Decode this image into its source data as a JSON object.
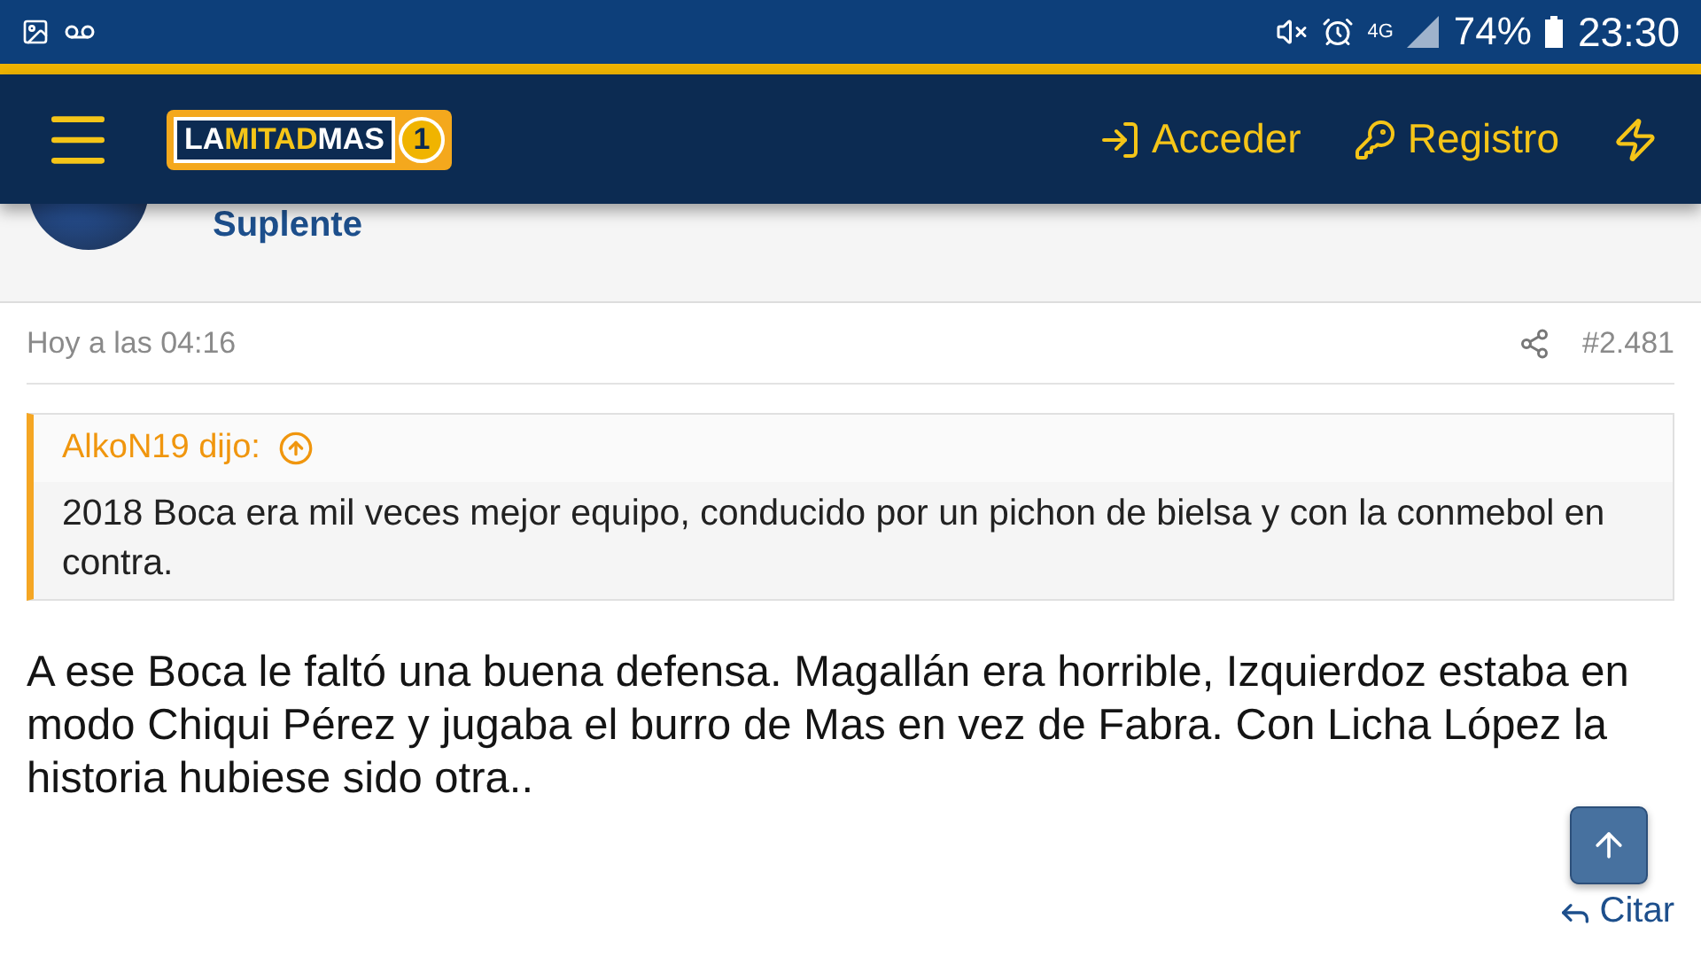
{
  "status_bar": {
    "network": "4G",
    "battery": "74%",
    "time": "23:30"
  },
  "nav": {
    "logo": {
      "parts": [
        "LA",
        "MITAD",
        "MAS"
      ],
      "badge": "1"
    },
    "links": [
      {
        "label": "Acceder",
        "kind": "login"
      },
      {
        "label": "Registro",
        "kind": "register"
      }
    ]
  },
  "author": {
    "title": "Suplente"
  },
  "post": {
    "date": "Hoy a las 04:16",
    "number": "#2.481",
    "quote": {
      "author": "AlkoN19 dijo:",
      "text": "2018 Boca era mil veces mejor equipo, conducido por un pichon de bielsa y con la conmebol en contra."
    },
    "message": "A ese Boca le faltó una buena defensa. Magallán era horrible, Izquierdoz estaba en modo Chiqui Pérez y jugaba el burro de Mas en vez de Fabra. Con Licha López la historia hubiese sido otra..",
    "actions": [
      "Citar"
    ]
  }
}
